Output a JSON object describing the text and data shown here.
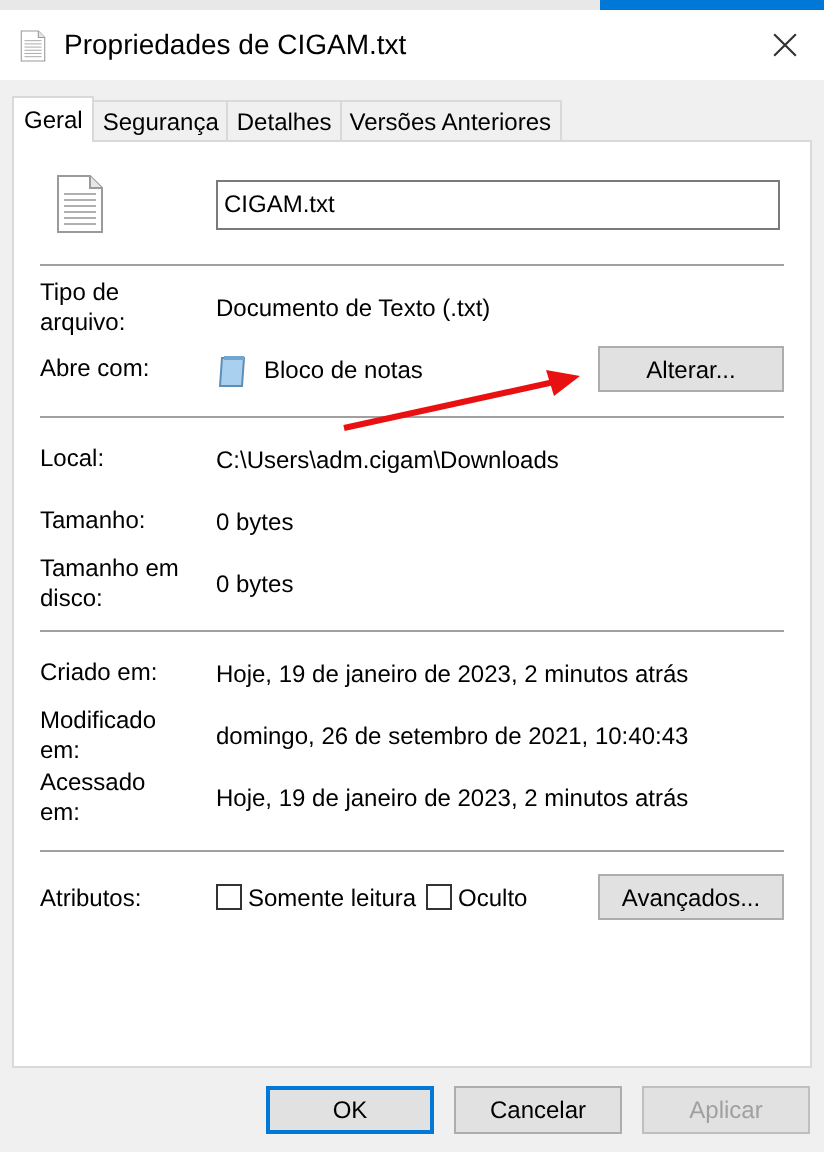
{
  "window": {
    "title": "Propriedades de CIGAM.txt"
  },
  "tabs": [
    {
      "label": "Geral",
      "selected": true
    },
    {
      "label": "Segurança",
      "selected": false
    },
    {
      "label": "Detalhes",
      "selected": false
    },
    {
      "label": "Versões Anteriores",
      "selected": false
    }
  ],
  "file_name": "CIGAM.txt",
  "sections": [
    [
      {
        "kind": "text",
        "label": "Tipo de arquivo:",
        "value": "Documento de Texto (.txt)"
      },
      {
        "kind": "app",
        "label": "Abre com:",
        "value": "Bloco de notas",
        "button": "Alterar..."
      }
    ],
    [
      {
        "kind": "text",
        "label": "Local:",
        "value": "C:\\Users\\adm.cigam\\Downloads"
      },
      {
        "kind": "text",
        "label": "Tamanho:",
        "value": "0 bytes"
      },
      {
        "kind": "text",
        "label": "Tamanho em disco:",
        "value": "0 bytes"
      }
    ],
    [
      {
        "kind": "text",
        "label": "Criado em:",
        "value": "Hoje, 19 de janeiro de 2023, 2 minutos atrás"
      },
      {
        "kind": "text",
        "label": "Modificado em:",
        "value": "domingo, 26 de setembro de 2021, 10:40:43"
      },
      {
        "kind": "text",
        "label": "Acessado em:",
        "value": "Hoje, 19 de janeiro de 2023, 2 minutos atrás"
      }
    ]
  ],
  "attributes": {
    "label": "Atributos:",
    "options": [
      {
        "label": "Somente leitura",
        "checked": false
      },
      {
        "label": "Oculto",
        "checked": false
      }
    ],
    "button": "Avançados..."
  },
  "buttons": [
    {
      "label": "OK",
      "default": true,
      "disabled": false
    },
    {
      "label": "Cancelar",
      "default": false,
      "disabled": false
    },
    {
      "label": "Aplicar",
      "default": false,
      "disabled": true
    }
  ]
}
